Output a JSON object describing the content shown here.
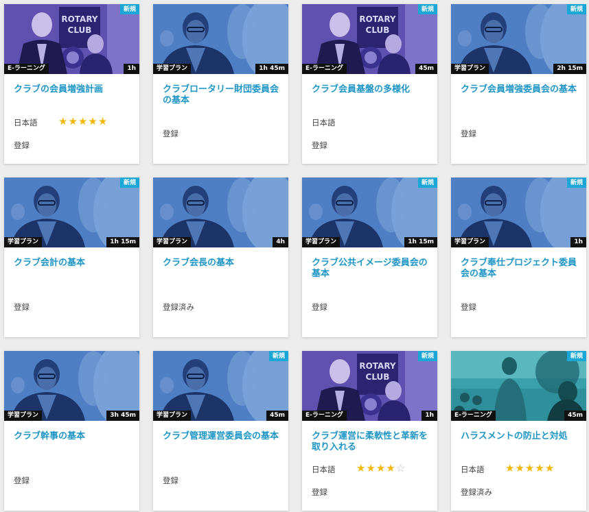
{
  "cards": [
    {
      "image": "rotary-club-speaker",
      "new_badge": "新規",
      "type": "E-ラーニング",
      "duration": "1h",
      "title": "クラブの会員増強計画",
      "language": "日本語",
      "rating": 5,
      "status": "登録"
    },
    {
      "image": "woman-portrait",
      "new_badge": "",
      "type": "学習プラン",
      "duration": "1h 45m",
      "title": "クラブロータリー財団委員会の基本",
      "language": "",
      "rating": 0,
      "status": "登録"
    },
    {
      "image": "rotary-club-speaker",
      "new_badge": "新規",
      "type": "E-ラーニング",
      "duration": "45m",
      "title": "クラブ会員基盤の多様化",
      "language": "日本語",
      "rating": 0,
      "status": "登録"
    },
    {
      "image": "woman-portrait",
      "new_badge": "新規",
      "type": "学習プラン",
      "duration": "2h 15m",
      "title": "クラブ会員増強委員会の基本",
      "language": "",
      "rating": 0,
      "status": "登録"
    },
    {
      "image": "woman-portrait",
      "new_badge": "新規",
      "type": "学習プラン",
      "duration": "1h 15m",
      "title": "クラブ会計の基本",
      "language": "",
      "rating": 0,
      "status": "登録"
    },
    {
      "image": "woman-portrait",
      "new_badge": "",
      "type": "学習プラン",
      "duration": "4h",
      "title": "クラブ会長の基本",
      "language": "",
      "rating": 0,
      "status": "登録済み"
    },
    {
      "image": "woman-portrait",
      "new_badge": "新規",
      "type": "学習プラン",
      "duration": "1h 15m",
      "title": "クラブ公共イメージ委員会の基本",
      "language": "",
      "rating": 0,
      "status": "登録"
    },
    {
      "image": "woman-portrait",
      "new_badge": "新規",
      "type": "学習プラン",
      "duration": "1h",
      "title": "クラブ奉仕プロジェクト委員会の基本",
      "language": "",
      "rating": 0,
      "status": "登録"
    },
    {
      "image": "woman-portrait",
      "new_badge": "",
      "type": "学習プラン",
      "duration": "3h 45m",
      "title": "クラブ幹事の基本",
      "language": "",
      "rating": 0,
      "status": "登録"
    },
    {
      "image": "woman-portrait",
      "new_badge": "新規",
      "type": "学習プラン",
      "duration": "45m",
      "title": "クラブ管理運営委員会の基本",
      "language": "",
      "rating": 0,
      "status": "登録"
    },
    {
      "image": "rotary-club-speaker",
      "new_badge": "新規",
      "type": "E-ラーニング",
      "duration": "1h",
      "title": "クラブ運営に柔軟性と革新を取り入れる",
      "language": "日本語",
      "rating": 4,
      "status": "登録"
    },
    {
      "image": "community-meeting",
      "new_badge": "新規",
      "type": "E-ラーニング",
      "duration": "45m",
      "title": "ハラスメントの防止と対処",
      "language": "日本語",
      "rating": 5,
      "status": "登録済み"
    }
  ],
  "colors": {
    "title": "#1d95c5",
    "new_badge": "#1aa6d6",
    "star": "#f2b705",
    "rotary_tint": "#5a4aa8",
    "portrait_tint": "#3d6fb8",
    "community_tint": "#2f8f9a"
  }
}
